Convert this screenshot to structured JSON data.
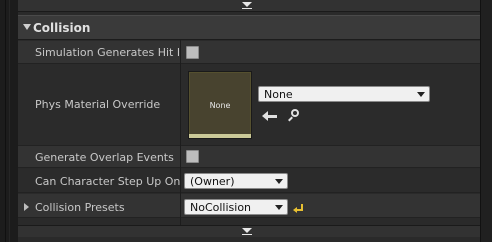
{
  "section": {
    "title": "Collision"
  },
  "rows": {
    "simulation_hit_events": {
      "label": "Simulation Generates Hit Eve",
      "checked": false
    },
    "phys_material_override": {
      "label": "Phys Material Override",
      "thumbnail_text": "None",
      "combo_value": "None",
      "browse_icon": "left-arrow-icon",
      "find_icon": "magnifier-icon"
    },
    "generate_overlap_events": {
      "label": "Generate Overlap Events",
      "checked": false
    },
    "can_character_step_up_on": {
      "label": "Can Character Step Up On",
      "value": "(Owner)"
    },
    "collision_presets": {
      "label": "Collision Presets",
      "value": "NoCollision",
      "reset_icon": "reset-to-default-icon"
    }
  },
  "colors": {
    "panel": "#2a2a2a",
    "header": "#3a3a3a",
    "thumbnail": "#48432f",
    "reset_accent": "#e8c032"
  }
}
